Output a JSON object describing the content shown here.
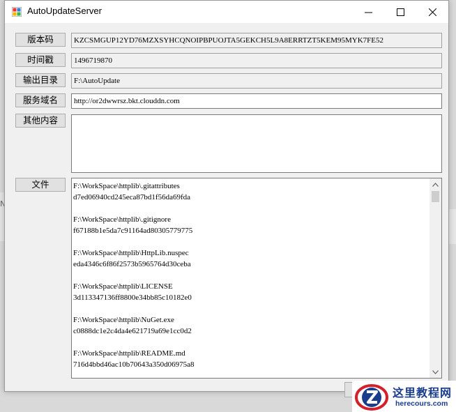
{
  "window": {
    "title": "AutoUpdateServer"
  },
  "form": {
    "version": {
      "label": "版本码",
      "value": "KZCSMGUP12YD76MZXSYHCQNOIPBPUOJTA5GEKCH5L9A8ERRTZT5KEM95MYK7FE52"
    },
    "timestamp": {
      "label": "时间戳",
      "value": "1496719870"
    },
    "output_dir": {
      "label": "输出目录",
      "value": "F:\\AutoUpdate"
    },
    "domain": {
      "label": "服务域名",
      "value": "http://or2dwwrsz.bkt.clouddn.com"
    },
    "other": {
      "label": "其他内容",
      "value": ""
    },
    "files": {
      "label": "文件",
      "entries": [
        {
          "path": "F:\\WorkSpace\\httplib\\.gitattributes",
          "hash": "d7ed06940cd245eca87bd1f56da69fda"
        },
        {
          "path": "F:\\WorkSpace\\httplib\\.gitignore",
          "hash": "f67188b1e5da7c91164ad80305779775"
        },
        {
          "path": "F:\\WorkSpace\\httplib\\HttpLib.nuspec",
          "hash": "eda4346c6f86f2573b5965764d30ceba"
        },
        {
          "path": "F:\\WorkSpace\\httplib\\LICENSE",
          "hash": "3d113347136ff8800e34bb85c10182e0"
        },
        {
          "path": "F:\\WorkSpace\\httplib\\NuGet.exe",
          "hash": "c0888dc1e2c4da4e621719a69e1cc0d2"
        },
        {
          "path": "F:\\WorkSpace\\httplib\\README.md",
          "hash": "716d4bbd46ac10b70643a350d06975a8"
        }
      ]
    }
  },
  "watermark": {
    "cn": "这里教程网",
    "en": "herecours.com"
  },
  "colors": {
    "window_bg": "#f0f0f0",
    "button_bg": "#e1e1e1",
    "watermark_blue": "#1a3e8c",
    "watermark_red": "#d4202a"
  }
}
